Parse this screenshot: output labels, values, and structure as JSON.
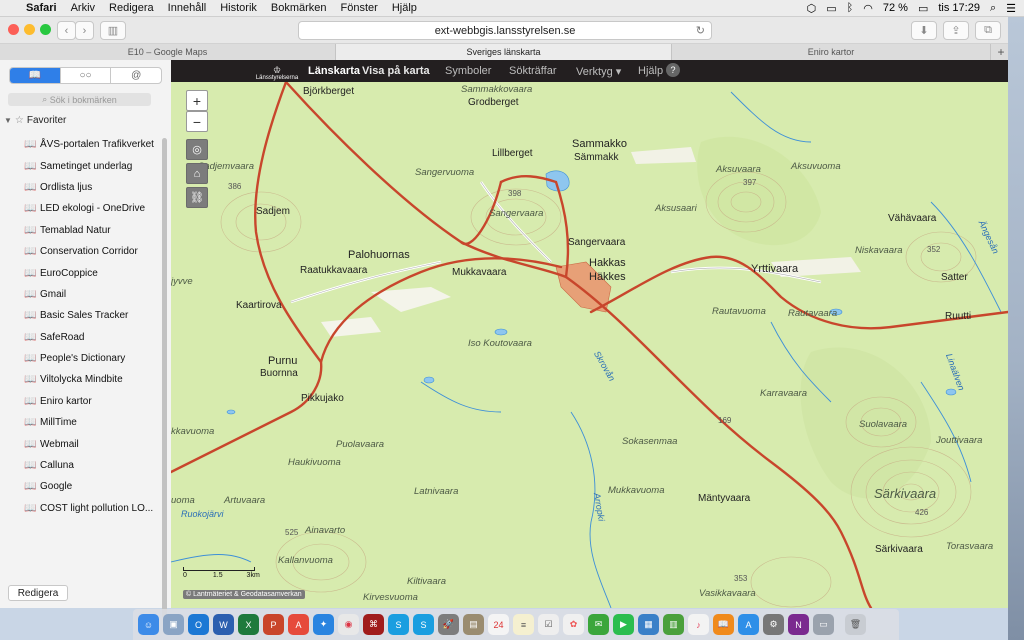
{
  "menubar": {
    "app": "Safari",
    "items": [
      "Arkiv",
      "Redigera",
      "Innehåll",
      "Historik",
      "Bokmärken",
      "Fönster",
      "Hjälp"
    ],
    "battery": "72 %",
    "clock": "tis 17:29"
  },
  "browser": {
    "url": "ext-webbgis.lansstyrelsen.se",
    "tabs": [
      "E10 – Google Maps",
      "Sveriges länskarta",
      "Eniro kartor"
    ],
    "active_tab": 1
  },
  "sidebar": {
    "search_placeholder": "Sök i bokmärken",
    "folder": "Favoriter",
    "bookmarks": [
      "ÅVS-portalen Trafikverket",
      "Sametinget underlag",
      "Ordlista ljus",
      "LED ekologi - OneDrive",
      "Temablad Natur",
      "Conservation Corridor",
      "EuroCoppice",
      "Gmail",
      "Basic Sales Tracker",
      "SafeRoad",
      "People's Dictionary",
      "Viltolycka Mindbite",
      "Eniro kartor",
      "MillTime",
      "Webmail",
      "Calluna",
      "Google",
      "COST light pollution LO..."
    ],
    "edit_label": "Redigera"
  },
  "app": {
    "logo_text": "Länsstyrelserna",
    "nav": [
      "Länskarta",
      "Visa på karta",
      "Symboler",
      "Sökträffar",
      "Verktyg ▾",
      "Hjälp"
    ],
    "help_symbol": "?"
  },
  "map": {
    "zoom_in": "+",
    "zoom_out": "−",
    "scale_labels": [
      "0",
      "1.5",
      "3km"
    ],
    "copyright": "© Lantmäteriet & Geodatasamverkan",
    "places": {
      "bjorkberget": "Björkberget",
      "sammakkovaara_top": "Sammakkovaara",
      "grodberget": "Grodberget",
      "sammakko": "Sammakko",
      "sammakk": "Sämmakk",
      "lillberget": "Lillberget",
      "aksuvaara": "Aksuvaara",
      "aksuvuoma": "Aksuvuoma",
      "sadjemvaara": "Sadjemvaara",
      "sangervuoma": "Sangervuoma",
      "sadjem": "Sadjem",
      "sangervaara_it": "Sangervaara",
      "aksusaari": "Aksusaari",
      "vahavaara": "Vähävaara",
      "sangervaara": "Sangervaara",
      "palohuornas": "Palohuornas",
      "niskavaara": "Niskavaara",
      "hakkas": "Hakkas",
      "hakkes": "Häkkes",
      "raatukkavaara": "Raatukkavaara",
      "mukkavaara": "Mukkavaara",
      "yrttivaara": "Yrttivaara",
      "satter": "Satter",
      "kaartirova": "Kaartirova",
      "rautavuoma": "Rautavuoma",
      "rautavaara": "Rautavaara",
      "ruutti": "Ruutti",
      "iso_koutovaara": "Iso Koutovaara",
      "purnu": "Purnu",
      "buornna": "Buornna",
      "skrovan": "Skrovån",
      "pikkujako": "Pikkujako",
      "karravaara": "Karravaara",
      "linaalven": "Linaälven",
      "kkavuoma": "kkavuoma",
      "suolavaara": "Suolavaara",
      "jouttivaara": "Jouttivaara",
      "puolavaara": "Puolavaara",
      "sokasenmaa": "Sokasenmaa",
      "haukivuoma": "Haukivuoma",
      "latnivaara": "Latnivaara",
      "mukkavuoma": "Mukkavuoma",
      "mantyvaara": "Mäntyvaara",
      "sarkivaara_big": "Särkivaara",
      "uoma": "uoma",
      "artuvaara": "Artuvaara",
      "ruokojarvi": "Ruokojärvi",
      "ainavarto": "Ainavarto",
      "arropki": "Arropki",
      "sarkivaara": "Särkivaara",
      "torasvaara": "Torasvaara",
      "kallanvuoma": "Kallanvuoma",
      "kiltivaara": "Kiltivaara",
      "vasikkavaara": "Vasikkavaara",
      "kirvesvuoma": "Kirvesvuoma",
      "jyvve": "jyvve",
      "angesan": "Ängesån"
    },
    "heights": [
      "386",
      "398",
      "397",
      "352",
      "169",
      "426",
      "525",
      "353"
    ]
  },
  "dock": {
    "calendar_day": "24",
    "badge_appstore": "1"
  }
}
